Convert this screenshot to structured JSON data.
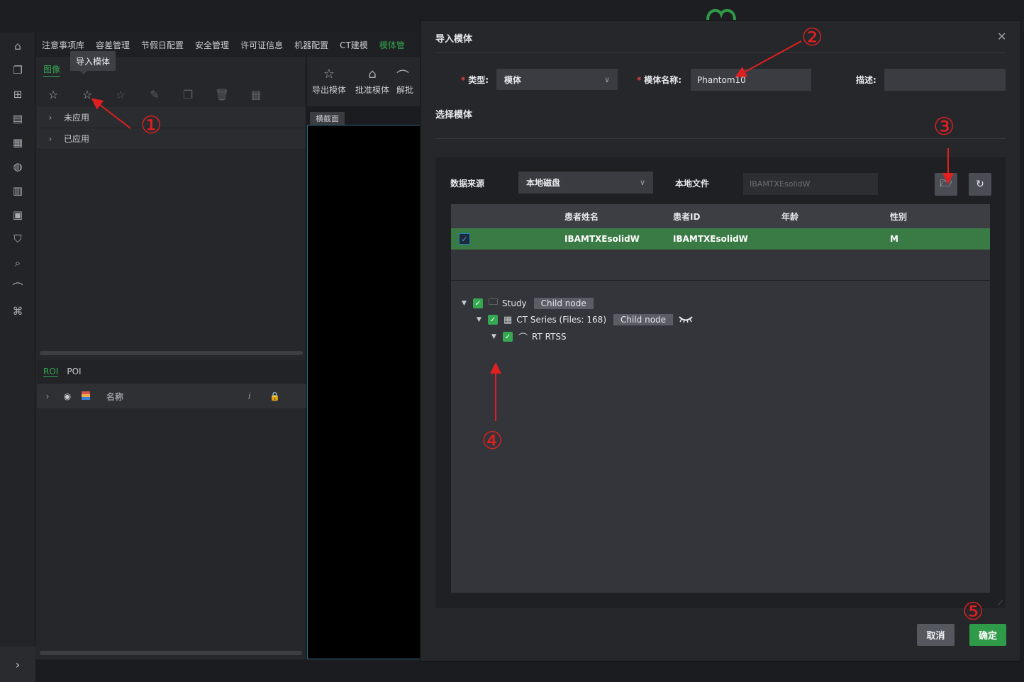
{
  "menu": {
    "items": [
      "注意事项库",
      "容差管理",
      "节假日配置",
      "安全管理",
      "许可证信息",
      "机器配置",
      "CT建模",
      "模体管"
    ],
    "active_index": 7
  },
  "left_panel": {
    "subtab": "图像",
    "tooltip": "导入模体",
    "tree": [
      {
        "label": "未应用"
      },
      {
        "label": "已应用"
      }
    ],
    "roi_tabs": {
      "roi": "ROI",
      "poi": "POI"
    },
    "roi_header": {
      "name": "名称",
      "info_icon": "i"
    }
  },
  "middle": {
    "tools": [
      {
        "label": "导出模体",
        "icon": "export-star-icon"
      },
      {
        "label": "批准模体",
        "icon": "approve-lock-icon"
      },
      {
        "label": "解批",
        "icon": "unapprove-icon"
      }
    ],
    "viewer_label": "横截面"
  },
  "dialog": {
    "title": "导入模体",
    "type_label": "类型:",
    "type_value": "模体",
    "name_label": "模体名称:",
    "name_value": "Phantom10",
    "desc_label": "描述:",
    "desc_value": "",
    "section_title": "选择模体",
    "source_label": "数据来源",
    "source_value": "本地磁盘",
    "local_file_label": "本地文件",
    "local_file_placeholder": "IBAMTXEsolidW",
    "table": {
      "columns": [
        "患者姓名",
        "患者ID",
        "年龄",
        "性别"
      ],
      "rows": [
        {
          "name": "IBAMTXEsolidW",
          "id": "IBAMTXEsolidW",
          "age": "",
          "sex": "M",
          "checked": true
        }
      ]
    },
    "tree": {
      "study": {
        "label": "Study",
        "tag": "Child node"
      },
      "series": {
        "label": "CT Series (Files: 168)",
        "tag": "Child node"
      },
      "rtss": {
        "label": "RT RTSS"
      }
    },
    "cancel_label": "取消",
    "ok_label": "确定"
  },
  "annotations": [
    "①",
    "②",
    "③",
    "④",
    "⑤"
  ],
  "colors": {
    "accent": "#35a852",
    "selected_row": "#3a7a45",
    "annotation": "#e02020"
  }
}
